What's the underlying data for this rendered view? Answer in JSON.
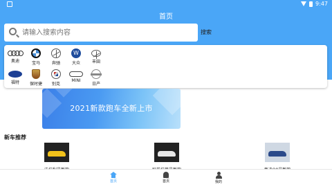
{
  "status_bar": {
    "time": "9:47"
  },
  "header": {
    "title": "首页"
  },
  "search": {
    "placeholder": "请输入搜索内容",
    "button_label": "搜索"
  },
  "brands": [
    {
      "label": "奥迪",
      "icon": "audi-logo-icon"
    },
    {
      "label": "宝马",
      "icon": "bmw-logo-icon"
    },
    {
      "label": "奔驰",
      "icon": "mercedes-logo-icon"
    },
    {
      "label": "大众",
      "icon": "volkswagen-logo-icon"
    },
    {
      "label": "丰田",
      "icon": "toyota-logo-icon"
    },
    {
      "label": "福特",
      "icon": "ford-logo-icon"
    },
    {
      "label": "保时捷",
      "icon": "porsche-logo-icon"
    },
    {
      "label": "别克",
      "icon": "buick-logo-icon"
    },
    {
      "label": "MINI",
      "icon": "mini-logo-icon"
    },
    {
      "label": "日产",
      "icon": "nissan-logo-icon"
    }
  ],
  "banner": {
    "title": "2021新款跑车全新上市"
  },
  "section": {
    "title": "新车推荐"
  },
  "cars": [
    {
      "name": "法拉利最新款",
      "color": "#f2c21b"
    },
    {
      "name": "玛莎拉蒂最新款",
      "color": "#e8e8e8"
    },
    {
      "name": "奥迪Q8最新款",
      "color": "#2b4a8a"
    }
  ],
  "bottom_nav": [
    {
      "label": "首页",
      "icon": "home-icon",
      "active": true
    },
    {
      "label": "首页",
      "icon": "bell-icon",
      "active": false
    },
    {
      "label": "我的",
      "icon": "user-icon",
      "active": false
    }
  ],
  "colors": {
    "accent": "#4aa6f7"
  }
}
